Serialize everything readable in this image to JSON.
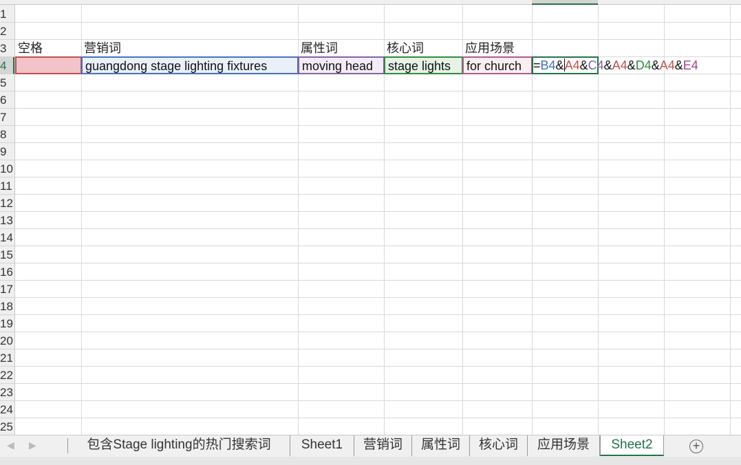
{
  "rows": [
    "1",
    "2",
    "3",
    "4",
    "5",
    "6",
    "7",
    "8",
    "9",
    "10",
    "11",
    "12",
    "13",
    "14",
    "15",
    "16",
    "17",
    "18",
    "19",
    "20",
    "21",
    "22",
    "23",
    "24",
    "25"
  ],
  "headers": {
    "a3": "空格",
    "b3": "营销词",
    "c3": "属性词",
    "d3": "核心词",
    "e3": "应用场景"
  },
  "cells": {
    "a4": "",
    "b4": "guangdong stage lighting fixtures",
    "c4": "moving head",
    "d4": "stage lights",
    "e4": "for church"
  },
  "formula": {
    "eq": "=",
    "p1": "B4",
    "amp": "&",
    "p2": "A4",
    "p3": "C4",
    "p4": "D4",
    "p5": "E4"
  },
  "tabs": [
    "包含Stage lighting的热门搜索词",
    "Sheet1",
    "营销词",
    "属性词",
    "核心词",
    "应用场景",
    "Sheet2"
  ],
  "active_tab": "Sheet2",
  "icons": {
    "prev": "triangle-left-icon",
    "next": "triangle-right-icon",
    "add": "plus-circle-icon"
  },
  "colors": {
    "accent": "#217346",
    "a4_fill": "#f2c3c9",
    "b4_fill": "#e9f0fa",
    "c4_fill": "#f3ecf7",
    "d4_fill": "#e6f2e6",
    "e4_fill": "#fbeef0"
  }
}
